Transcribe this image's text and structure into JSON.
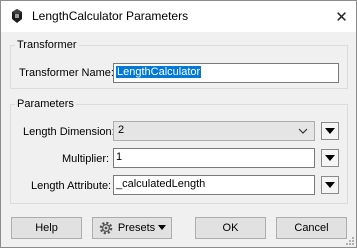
{
  "window": {
    "title": "LengthCalculator Parameters",
    "close_glyph": "✕"
  },
  "transformer_group": {
    "legend": "Transformer",
    "name_label": "Transformer Name:",
    "name_value": "LengthCalculator"
  },
  "parameters_group": {
    "legend": "Parameters",
    "dimension_label": "Length Dimension:",
    "dimension_value": "2",
    "multiplier_label": "Multiplier:",
    "multiplier_value": "1",
    "attribute_label": "Length Attribute:",
    "attribute_value": "_calculatedLength"
  },
  "buttons": {
    "help": "Help",
    "presets": "Presets",
    "ok": "OK",
    "cancel": "Cancel"
  },
  "colors": {
    "selection": "#0078d7",
    "background": "#f0f0f0"
  }
}
